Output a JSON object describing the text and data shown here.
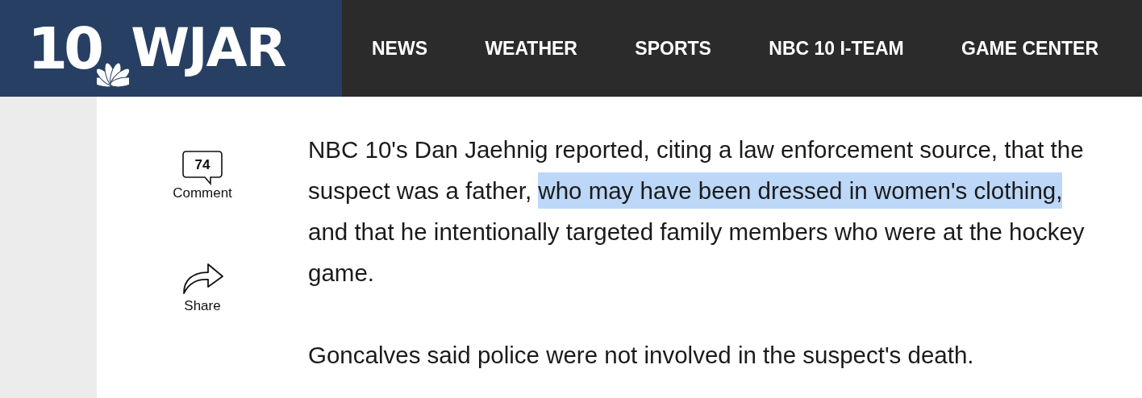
{
  "header": {
    "logo": {
      "number": "10",
      "letters": "WJAR"
    },
    "nav": [
      {
        "label": "NEWS"
      },
      {
        "label": "WEATHER"
      },
      {
        "label": "SPORTS"
      },
      {
        "label": "NBC 10 I-TEAM"
      },
      {
        "label": "GAME CENTER"
      }
    ]
  },
  "actions": {
    "comment": {
      "count": "74",
      "label": "Comment"
    },
    "share": {
      "label": "Share"
    }
  },
  "article": {
    "paragraphs": [
      {
        "segments": [
          {
            "text": "NBC 10's Dan Jaehnig reported, citing a law enforcement source, that the suspect was a father, ",
            "highlighted": false
          },
          {
            "text": "who may have been dressed in women's clothing,",
            "highlighted": true
          },
          {
            "text": " and that he intentionally targeted family members who were at the hockey game.",
            "highlighted": false
          }
        ]
      },
      {
        "segments": [
          {
            "text": "Goncalves said police were not involved in the suspect's death.",
            "highlighted": false
          }
        ]
      }
    ]
  }
}
